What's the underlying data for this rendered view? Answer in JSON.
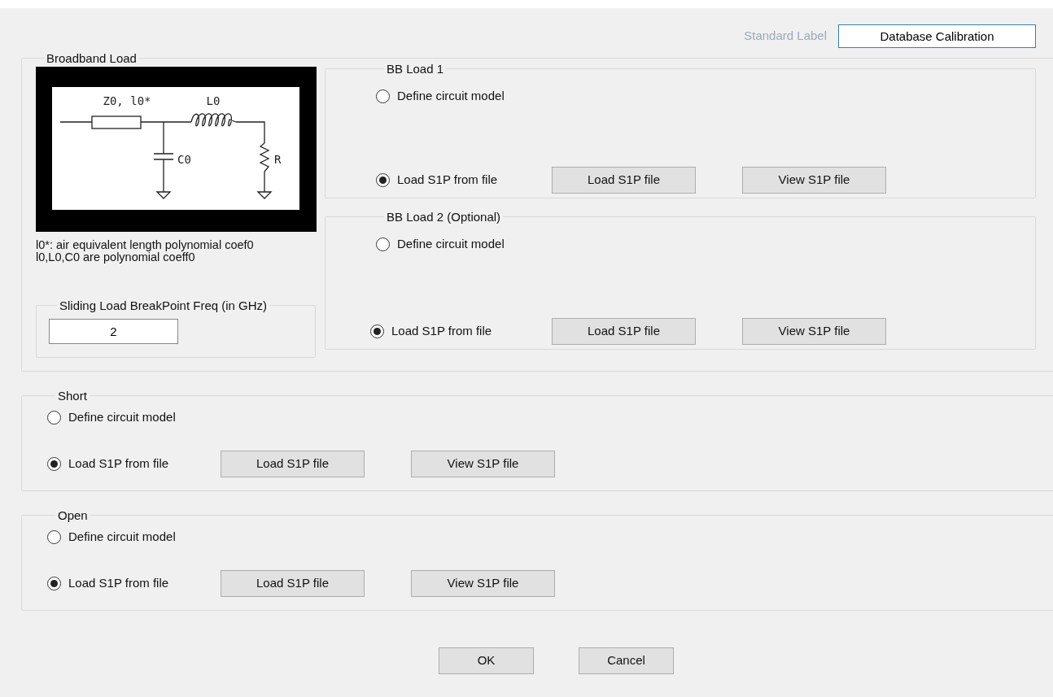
{
  "standard_label": {
    "label": "Standard Label",
    "value": "Database Calibration",
    "focused": true
  },
  "broadband_load": {
    "title": "Broadband Load",
    "diagram_labels": [
      "Z0, l0*",
      "L0",
      "C0",
      "R"
    ],
    "notes": [
      "l0*: air equivalent length polynomial coef0",
      "l0,L0,C0 are polynomial coeff0"
    ],
    "breakpoint": {
      "title": "Sliding Load BreakPoint Freq (in GHz)",
      "value": "2"
    },
    "loads": [
      {
        "title": "BB Load 1",
        "options": [
          {
            "label": "Define circuit model",
            "selected": false
          },
          {
            "label": "Load S1P from file",
            "selected": true
          }
        ],
        "buttons": [
          "Load S1P file",
          "View S1P file"
        ]
      },
      {
        "title": "BB Load 2 (Optional)",
        "options": [
          {
            "label": "Define circuit model",
            "selected": false
          },
          {
            "label": "Load S1P from file",
            "selected": true
          }
        ],
        "buttons": [
          "Load S1P file",
          "View S1P file"
        ]
      }
    ]
  },
  "standards": [
    {
      "title": "Short",
      "options": [
        {
          "label": "Define circuit model",
          "selected": false
        },
        {
          "label": "Load S1P from file",
          "selected": true
        }
      ],
      "buttons": [
        "Load S1P file",
        "View S1P file"
      ]
    },
    {
      "title": "Open",
      "options": [
        {
          "label": "Define circuit model",
          "selected": false
        },
        {
          "label": "Load S1P from file",
          "selected": true
        }
      ],
      "buttons": [
        "Load S1P file",
        "View S1P file"
      ]
    }
  ],
  "buttons": [
    "OK",
    "Cancel"
  ]
}
